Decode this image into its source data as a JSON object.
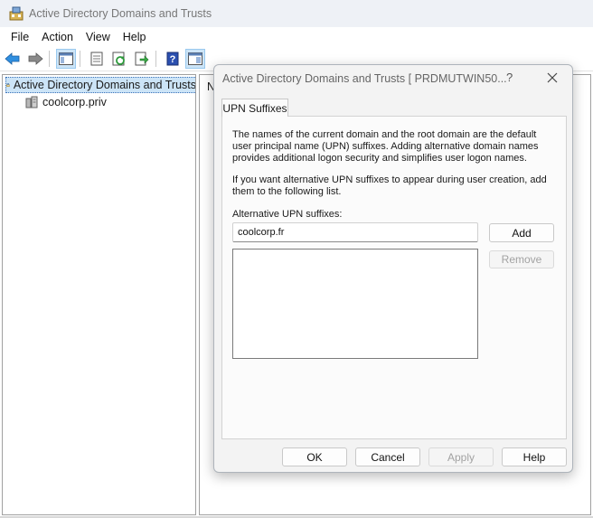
{
  "window": {
    "title": "Active Directory Domains and Trusts",
    "app_icon": "ad-domains-trusts-icon"
  },
  "menu": {
    "items": [
      "File",
      "Action",
      "View",
      "Help"
    ]
  },
  "toolbar": {
    "buttons": [
      "back-arrow-icon",
      "forward-arrow-icon",
      "show-hide-console-tree-icon",
      "properties-icon",
      "refresh-icon",
      "export-list-icon",
      "help-icon",
      "show-action-pane-icon"
    ]
  },
  "tree": {
    "root_label": "Active Directory Domains and Trusts",
    "child_label": "coolcorp.priv"
  },
  "right_pane": {
    "column_header": "N"
  },
  "dialog": {
    "title": "Active Directory Domains and Trusts [ PRDMUTWIN50...",
    "help_glyph": "?",
    "tab_label": "UPN Suffixes",
    "description_1": "The names of the current domain and the root domain are the default user principal name (UPN) suffixes. Adding alternative domain names provides additional logon security and simplifies user logon names.",
    "description_2": "If you want alternative UPN suffixes to appear during user creation, add them to the following list.",
    "field_label": "Alternative UPN suffixes:",
    "input_value": "coolcorp.fr",
    "add_label": "Add",
    "remove_label": "Remove",
    "list_items": [],
    "ok_label": "OK",
    "cancel_label": "Cancel",
    "apply_label": "Apply",
    "help_label": "Help"
  }
}
